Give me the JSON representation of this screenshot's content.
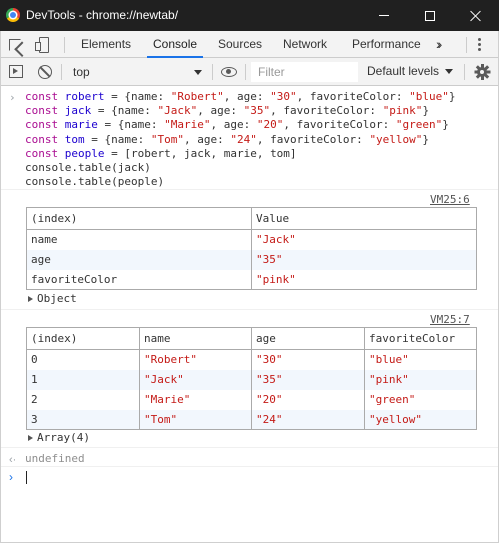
{
  "window": {
    "title": "DevTools - chrome://newtab/"
  },
  "tabs": [
    "Elements",
    "Console",
    "Sources",
    "Network",
    "Performance"
  ],
  "toolbar": {
    "context": "top",
    "filter_placeholder": "Filter",
    "levels": "Default levels"
  },
  "code": [
    [
      [
        "kw",
        "const "
      ],
      [
        "var",
        "robert"
      ],
      [
        "txt",
        " = {name: "
      ],
      [
        "str",
        "\"Robert\""
      ],
      [
        "txt",
        ", age: "
      ],
      [
        "str",
        "\"30\""
      ],
      [
        "txt",
        ", favoriteColor: "
      ],
      [
        "str",
        "\"blue\""
      ],
      [
        "txt",
        "}"
      ]
    ],
    [
      [
        "kw",
        "const "
      ],
      [
        "var",
        "jack"
      ],
      [
        "txt",
        " = {name: "
      ],
      [
        "str",
        "\"Jack\""
      ],
      [
        "txt",
        ", age: "
      ],
      [
        "str",
        "\"35\""
      ],
      [
        "txt",
        ", favoriteColor: "
      ],
      [
        "str",
        "\"pink\""
      ],
      [
        "txt",
        "}"
      ]
    ],
    [
      [
        "kw",
        "const "
      ],
      [
        "var",
        "marie"
      ],
      [
        "txt",
        " = {name: "
      ],
      [
        "str",
        "\"Marie\""
      ],
      [
        "txt",
        ", age: "
      ],
      [
        "str",
        "\"20\""
      ],
      [
        "txt",
        ", favoriteColor: "
      ],
      [
        "str",
        "\"green\""
      ],
      [
        "txt",
        "}"
      ]
    ],
    [
      [
        "kw",
        "const "
      ],
      [
        "var",
        "tom"
      ],
      [
        "txt",
        " = {name: "
      ],
      [
        "str",
        "\"Tom\""
      ],
      [
        "txt",
        ", age: "
      ],
      [
        "str",
        "\"24\""
      ],
      [
        "txt",
        ", favoriteColor: "
      ],
      [
        "str",
        "\"yellow\""
      ],
      [
        "txt",
        "}"
      ]
    ],
    [
      [
        "kw",
        "const "
      ],
      [
        "var",
        "people"
      ],
      [
        "txt",
        " = [robert, jack, marie, tom]"
      ]
    ],
    [
      [
        "txt",
        "console.table(jack)"
      ]
    ],
    [
      [
        "txt",
        "console.table(people)"
      ]
    ]
  ],
  "table1": {
    "source": "VM25:6",
    "headers": [
      "(index)",
      "Value"
    ],
    "rows": [
      [
        "name",
        "\"Jack\""
      ],
      [
        "age",
        "\"35\""
      ],
      [
        "favoriteColor",
        "\"pink\""
      ]
    ],
    "expand_label": "Object"
  },
  "table2": {
    "source": "VM25:7",
    "headers": [
      "(index)",
      "name",
      "age",
      "favoriteColor"
    ],
    "rows": [
      [
        "0",
        "\"Robert\"",
        "\"30\"",
        "\"blue\""
      ],
      [
        "1",
        "\"Jack\"",
        "\"35\"",
        "\"pink\""
      ],
      [
        "2",
        "\"Marie\"",
        "\"20\"",
        "\"green\""
      ],
      [
        "3",
        "\"Tom\"",
        "\"24\"",
        "\"yellow\""
      ]
    ],
    "expand_label": "Array(4)"
  },
  "result": "undefined",
  "colors": {
    "keyword": "#aa0d91",
    "variable": "#1c00cf",
    "string": "#c41a16",
    "accent": "#1a73e8"
  }
}
